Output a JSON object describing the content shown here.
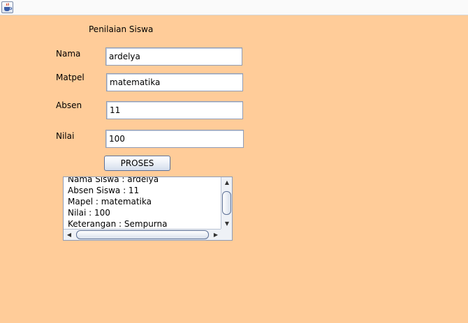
{
  "form": {
    "title": "Penilaian Siswa",
    "nama_label": "Nama",
    "nama_value": "ardelya",
    "matpel_label": "Matpel",
    "matpel_value": "matematika",
    "absen_label": "Absen",
    "absen_value": "11",
    "nilai_label": "Nilai",
    "nilai_value": "100",
    "proses_label": "PROSES"
  },
  "output": {
    "lines": [
      "Nama Siswa : ardelya",
      "Absen Siswa : 11",
      "Mapel : matematika",
      "Nilai : 100",
      "Keterangan : Sempurna"
    ]
  },
  "icons": {
    "window_icon": "java-coffee-icon",
    "scroll_up": "arrow-up-icon",
    "scroll_down": "arrow-down-icon",
    "scroll_left": "arrow-left-icon",
    "scroll_right": "arrow-right-icon"
  },
  "colors": {
    "background": "#ffcc99",
    "titlebar": "#fafafa"
  }
}
